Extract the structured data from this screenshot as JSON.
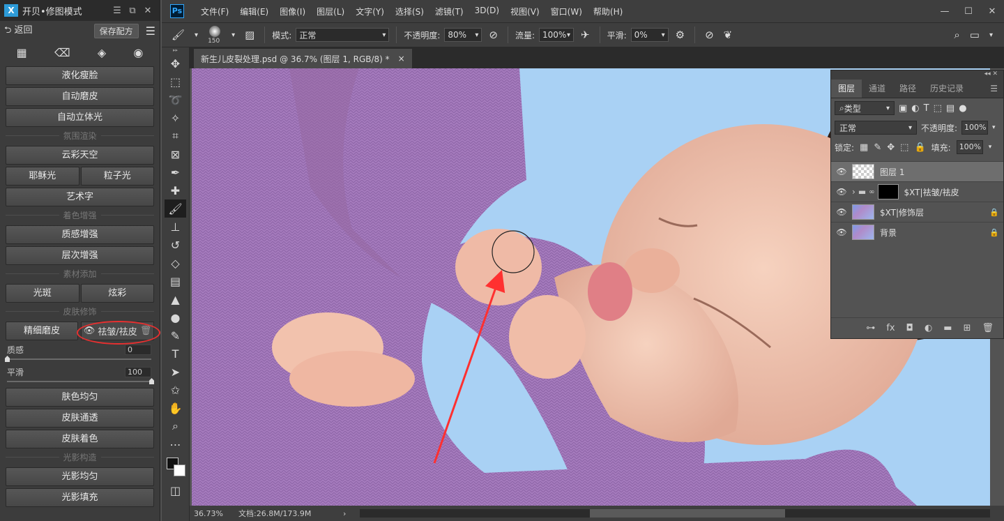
{
  "plugin": {
    "logo": "X",
    "title": "开贝•修图模式",
    "back_label": "返回",
    "save_label": "保存配方",
    "buttons": {
      "liquify": "液化瘦脸",
      "auto_smooth": "自动磨皮",
      "auto_3d_light": "自动立体光",
      "sky": "云彩天空",
      "jesus_light": "耶稣光",
      "particle_light": "粒子光",
      "art_text": "艺术字",
      "texture": "质感增强",
      "layer_enh": "层次增强",
      "spot": "光斑",
      "dazzle": "炫彩",
      "fine_smooth": "精细磨皮",
      "wrinkle": "祛皱/祛皮",
      "skin_even": "肤色均匀",
      "skin_clear": "皮肤通透",
      "skin_color": "皮肤着色",
      "light_even": "光影均匀",
      "light_fill": "光影填充"
    },
    "sections": {
      "atmosphere": "氛围渲染",
      "color_enh": "着色增强",
      "material": "素材添加",
      "skin": "皮肤修饰",
      "light": "光影构造"
    },
    "sliders": {
      "texture_label": "质感",
      "texture_value": "0",
      "texture_level": 0,
      "smooth_label": "平滑",
      "smooth_value": "100",
      "smooth_level": 100
    }
  },
  "ps": {
    "logo": "Ps",
    "menu": [
      "文件(F)",
      "编辑(E)",
      "图像(I)",
      "图层(L)",
      "文字(Y)",
      "选择(S)",
      "滤镜(T)",
      "3D(D)",
      "视图(V)",
      "窗口(W)",
      "帮助(H)"
    ],
    "options": {
      "brush_size": "150",
      "mode_label": "模式:",
      "mode_value": "正常",
      "opacity_label": "不透明度:",
      "opacity_value": "80%",
      "flow_label": "流量:",
      "flow_value": "100%",
      "smooth_label": "平滑:",
      "smooth_value": "0%"
    },
    "doc_tab": "新生儿皮裂处理.psd @ 36.7% (图层 1, RGB/8) *",
    "doc_tab_close": "×",
    "status": {
      "zoom": "36.73%",
      "doc": "文档:26.8M/173.9M"
    }
  },
  "layers_panel": {
    "tabs": [
      "图层",
      "通道",
      "路径",
      "历史记录"
    ],
    "filter_label": "类型",
    "blend_mode": "正常",
    "opacity_label": "不透明度:",
    "opacity_value": "100%",
    "lock_label": "锁定:",
    "fill_label": "填充:",
    "fill_value": "100%",
    "layers": [
      {
        "name": "图层 1"
      },
      {
        "name": "$XT|祛皱/祛皮"
      },
      {
        "name": "$XT|修饰层"
      },
      {
        "name": "背景"
      }
    ],
    "footer_fx": "fx"
  },
  "colors": {
    "plugin_bg": "#3c3c3c",
    "ps_bg": "#3e3e3e",
    "accent_red": "#e83030",
    "ps_blue": "#31a8ff",
    "blanket": "#a57bbd",
    "background_blue": "#a9d1f4"
  }
}
